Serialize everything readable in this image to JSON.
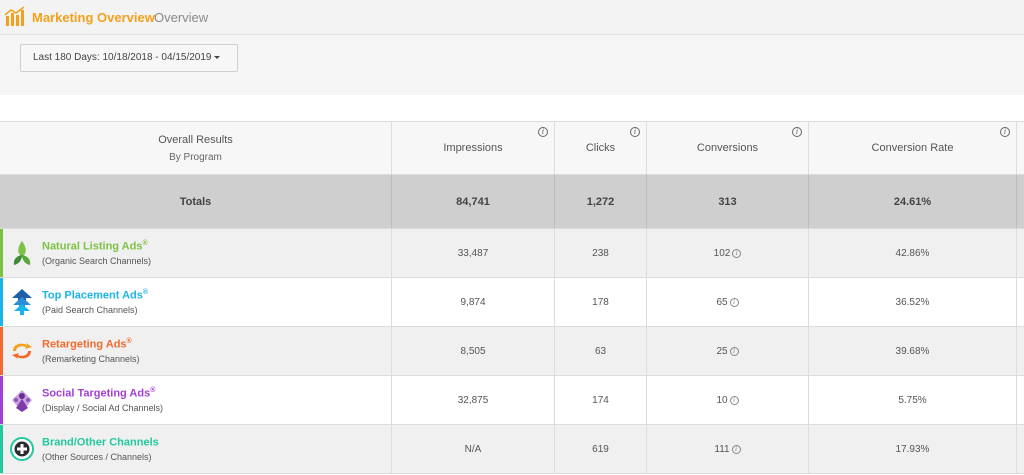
{
  "header": {
    "title": "Marketing Overview",
    "breadcrumb": "Overview",
    "brand_color": "#f5a01a"
  },
  "filter": {
    "date_range_label": "Last 180 Days: 10/18/2018 - 04/15/2019"
  },
  "table": {
    "columns": {
      "program_line1": "Overall Results",
      "program_line2": "By Program",
      "impressions": "Impressions",
      "clicks": "Clicks",
      "conversions": "Conversions",
      "conversion_rate": "Conversion Rate"
    },
    "info_glyph": "i",
    "totals": {
      "label": "Totals",
      "impressions": "84,741",
      "clicks": "1,272",
      "conversions": "313",
      "conversion_rate": "24.61%"
    },
    "rows": [
      {
        "name": "Natural Listing Ads",
        "mark": "®",
        "sub": "(Organic Search Channels)",
        "impressions": "33,487",
        "clicks": "238",
        "conversions": "102",
        "conversion_rate": "42.86%",
        "color": "#7dc242",
        "icon": "leaf-icon"
      },
      {
        "name": "Top Placement Ads",
        "mark": "®",
        "sub": "(Paid Search Channels)",
        "impressions": "9,874",
        "clicks": "178",
        "conversions": "65",
        "conversion_rate": "36.52%",
        "color": "#1cb3e8",
        "icon": "arrow-up-icon"
      },
      {
        "name": "Retargeting Ads",
        "mark": "®",
        "sub": "(Remarketing Channels)",
        "impressions": "8,505",
        "clicks": "63",
        "conversions": "25",
        "conversion_rate": "39.68%",
        "color": "#f26a2e",
        "icon": "swirl-arrow-icon"
      },
      {
        "name": "Social Targeting Ads",
        "mark": "®",
        "sub": "(Display / Social Ad Channels)",
        "impressions": "32,875",
        "clicks": "174",
        "conversions": "10",
        "conversion_rate": "5.75%",
        "color": "#a23fd6",
        "icon": "diamond-people-icon"
      },
      {
        "name": "Brand/Other Channels",
        "mark": "",
        "sub": "(Other Sources / Channels)",
        "impressions": "N/A",
        "clicks": "619",
        "conversions": "111",
        "conversion_rate": "17.93%",
        "color": "#22c8a0",
        "icon": "plus-circle-icon"
      }
    ]
  }
}
